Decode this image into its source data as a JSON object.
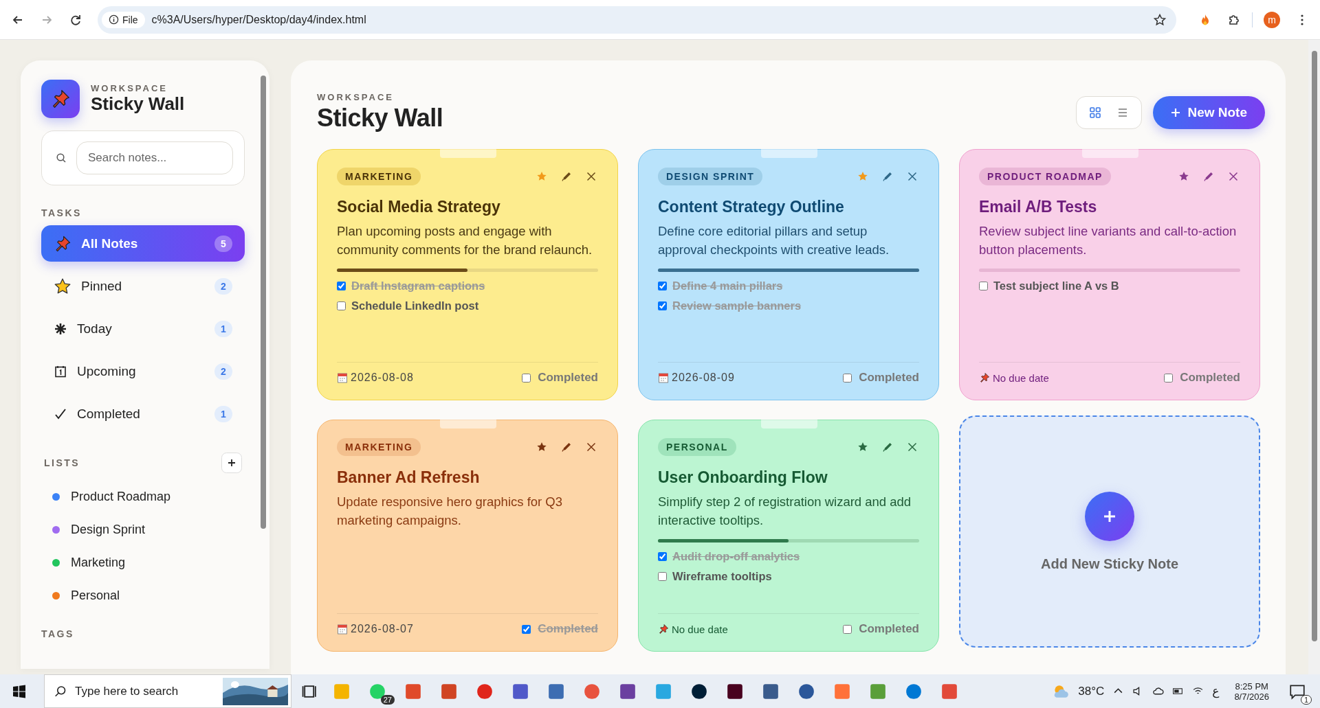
{
  "browser": {
    "scheme": "File",
    "url": "c%3A/Users/hyper/Desktop/day4/index.html",
    "profile_initial": "m"
  },
  "sidebar": {
    "eyebrow": "WORKSPACE",
    "title": "Sticky Wall",
    "search": {
      "placeholder": "Search notes..."
    },
    "tasks_heading": "TASKS",
    "tasks": [
      {
        "kind": "pin",
        "label": "All Notes",
        "count": "5",
        "selected": true
      },
      {
        "kind": "star",
        "label": "Pinned",
        "count": "2",
        "selected": false
      },
      {
        "kind": "asterisk",
        "label": "Today",
        "count": "1",
        "selected": false
      },
      {
        "kind": "calendar",
        "label": "Upcoming",
        "count": "2",
        "selected": false
      },
      {
        "kind": "check",
        "label": "Completed",
        "count": "1",
        "selected": false
      }
    ],
    "lists_heading": "LISTS",
    "lists": [
      {
        "label": "Product Roadmap",
        "color": "#3b82f6"
      },
      {
        "label": "Design Sprint",
        "color": "#a06cf0"
      },
      {
        "label": "Marketing",
        "color": "#22c55e"
      },
      {
        "label": "Personal",
        "color": "#f07a1e"
      }
    ],
    "tags_heading": "TAGS"
  },
  "main": {
    "eyebrow": "WORKSPACE",
    "title": "Sticky Wall",
    "view_toggle": [
      {
        "kind": "grid",
        "selected": true
      },
      {
        "kind": "list",
        "selected": false
      }
    ],
    "new_note_button": "New Note",
    "notes": [
      {
        "color": "#fdec8e",
        "tag": "MARKETING",
        "title": "Social Media Strategy",
        "body": "Plan upcoming posts and engage with community comments for the brand relaunch.",
        "pinned": true,
        "level": 0.5,
        "checklist": [
          {
            "text": "Draft Instagram captions",
            "checked": true
          },
          {
            "text": "Schedule LinkedIn post",
            "checked": false
          }
        ],
        "dated": true,
        "due": "2026-08-08",
        "completed_label": "Completed",
        "completed": false
      },
      {
        "color": "#b9e3fb",
        "tag": "DESIGN SPRINT",
        "title": "Content Strategy Outline",
        "body": "Define core editorial pillars and setup approval checkpoints with creative leads.",
        "pinned": true,
        "level": 1,
        "checklist": [
          {
            "text": "Define 4 main pillars",
            "checked": true
          },
          {
            "text": "Review sample banners",
            "checked": true
          }
        ],
        "dated": true,
        "due": "2026-08-09",
        "completed_label": "Completed",
        "completed": false
      },
      {
        "color": "#f9d0e8",
        "tag": "PRODUCT ROADMAP",
        "title": "Email A/B Tests",
        "body": "Review subject line variants and call-to-action button placements.",
        "pinned": false,
        "level": 0,
        "checklist": [
          {
            "text": "Test subject line A vs B",
            "checked": false
          }
        ],
        "dated": false,
        "due": "No due date",
        "completed_label": "Completed",
        "completed": false
      },
      {
        "color": "#fdd6a8",
        "tag": "MARKETING",
        "title": "Banner Ad Refresh",
        "body": "Update responsive hero graphics for Q3 marketing campaigns.",
        "pinned": false,
        "dated": true,
        "due": "2026-08-07",
        "completed_label": "Completed",
        "completed": true
      },
      {
        "color": "#bcf5d2",
        "tag": "PERSONAL",
        "title": "User Onboarding Flow",
        "body": "Simplify step 2 of registration wizard and add interactive tooltips.",
        "pinned": false,
        "level": 0.5,
        "checklist": [
          {
            "text": "Audit drop-off analytics",
            "checked": true
          },
          {
            "text": "Wireframe tooltips",
            "checked": false
          }
        ],
        "dated": false,
        "due": "No due date",
        "completed_label": "Completed",
        "completed": false
      }
    ],
    "add_card": "Add New Sticky Note"
  },
  "taskbar": {
    "search_placeholder": "Type here to search",
    "whatsapp_badge": "27",
    "weather": "38°C",
    "language": "ع",
    "time": "8:25 PM",
    "date": "8/7/2026",
    "notification_count": "1"
  }
}
